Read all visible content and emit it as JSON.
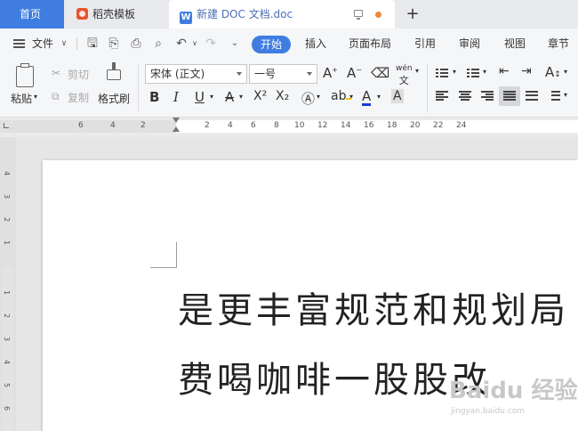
{
  "tabs": {
    "home": "首页",
    "daoke": "稻壳模板",
    "doc": "新建 DOC 文档.doc",
    "doc_icon": "W"
  },
  "menu": {
    "file": "文件",
    "items": [
      "开始",
      "插入",
      "页面布局",
      "引用",
      "审阅",
      "视图",
      "章节"
    ]
  },
  "ribbon": {
    "paste": "粘贴",
    "cut": "剪切",
    "copy": "复制",
    "format_painter": "格式刷",
    "font_name": "宋体 (正文)",
    "font_size": "一号",
    "bold": "B",
    "italic": "I",
    "underline": "U",
    "strike": "A",
    "superscript": "X²",
    "subscript": "X₂",
    "grow": "A",
    "shrink": "A",
    "font_color": "A",
    "char_shading": "A",
    "phonetic": "wén"
  },
  "ruler": {
    "h_numbers": [
      "6",
      "4",
      "2",
      "2",
      "4",
      "6",
      "8",
      "10",
      "12",
      "14",
      "16",
      "18",
      "20",
      "22",
      "24"
    ],
    "v_numbers": [
      "4",
      "3",
      "2",
      "1",
      "1",
      "2",
      "3",
      "4",
      "5",
      "6"
    ]
  },
  "document": {
    "line1": "是更丰富规范和规划局",
    "line2": "费喝咖啡一股股改"
  },
  "watermark": {
    "main": "Baidu 经验",
    "sub": "jingyan.baidu.com"
  },
  "colors": {
    "accent": "#3f7de0",
    "dirty_dot": "#f0883a"
  }
}
